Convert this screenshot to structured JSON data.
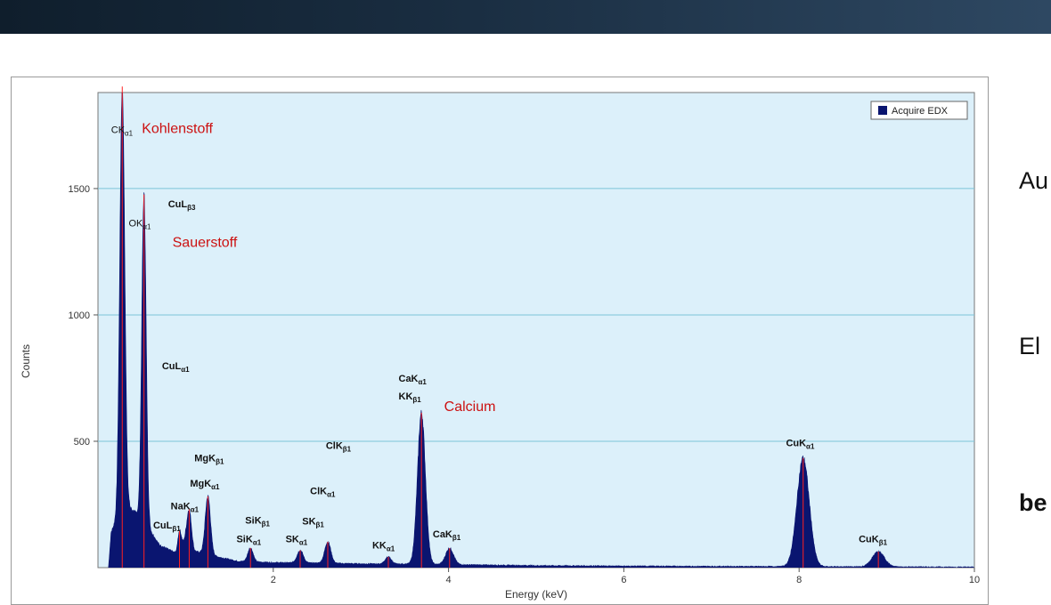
{
  "slide": {
    "side_texts": [
      "Au",
      "El",
      "be"
    ],
    "banner_color": "#1a2e42"
  },
  "chart_data": {
    "type": "area",
    "xlabel": "Energy (keV)",
    "ylabel": "Counts",
    "xlim": [
      0,
      10
    ],
    "ylim": [
      0,
      1880
    ],
    "xticks": [
      2,
      4,
      6,
      8,
      10
    ],
    "yticks": [
      500,
      1000,
      1500
    ],
    "grid": true,
    "plot_background": "#dcf0fa",
    "gridline_color": "#7cc4d8",
    "fill_color": "#0a1570",
    "marker_color": "#ff2020",
    "legend": {
      "label": "Acquire EDX",
      "position": "top-right",
      "color": "#0a1570"
    },
    "baseline_points": [
      [
        0.12,
        0
      ],
      [
        0.15,
        140
      ],
      [
        0.2,
        180
      ],
      [
        0.3,
        250
      ],
      [
        0.5,
        200
      ],
      [
        0.7,
        90
      ],
      [
        0.9,
        55
      ],
      [
        1.0,
        110
      ],
      [
        1.1,
        65
      ],
      [
        1.4,
        40
      ],
      [
        1.6,
        25
      ],
      [
        2.0,
        20
      ],
      [
        2.5,
        18
      ],
      [
        3.0,
        15
      ],
      [
        3.5,
        14
      ],
      [
        4.0,
        12
      ],
      [
        4.5,
        10
      ],
      [
        5.0,
        8
      ],
      [
        6.0,
        6
      ],
      [
        7.0,
        5
      ],
      [
        8.0,
        4
      ],
      [
        9.0,
        3
      ],
      [
        10.0,
        2
      ]
    ],
    "peaks": [
      {
        "energy": 0.277,
        "height": 1670,
        "width": 0.028,
        "line": "C Kα1",
        "element": "Kohlenstoff"
      },
      {
        "energy": 0.525,
        "height": 1290,
        "width": 0.025,
        "line": "O Kα1",
        "element": "Sauerstoff"
      },
      {
        "energy": 0.93,
        "height": 75,
        "width": 0.02,
        "line": "Cu Lα1"
      },
      {
        "energy": 1.041,
        "height": 140,
        "width": 0.025,
        "line": "Na Kα1"
      },
      {
        "energy": 1.254,
        "height": 230,
        "width": 0.03,
        "line": "Mg Kα1"
      },
      {
        "energy": 1.74,
        "height": 55,
        "width": 0.03,
        "line": "Si Kα1"
      },
      {
        "energy": 2.307,
        "height": 50,
        "width": 0.035,
        "line": "S Kα1"
      },
      {
        "energy": 2.622,
        "height": 85,
        "width": 0.035,
        "line": "Cl Kα1"
      },
      {
        "energy": 3.313,
        "height": 28,
        "width": 0.035,
        "line": "K Kα1"
      },
      {
        "energy": 3.691,
        "height": 600,
        "width": 0.045,
        "line": "Ca Kα1",
        "element": "Calcium"
      },
      {
        "energy": 4.012,
        "height": 65,
        "width": 0.045,
        "line": "Ca Kβ1"
      },
      {
        "energy": 8.046,
        "height": 430,
        "width": 0.07,
        "line": "Cu Kα1"
      },
      {
        "energy": 8.904,
        "height": 60,
        "width": 0.07,
        "line": "Cu Kβ1"
      }
    ],
    "annotations": [
      {
        "main": "CK",
        "sub": "α1",
        "x": 0.15,
        "y": 1720
      },
      {
        "main": "CuL",
        "sub": "β3",
        "x": 0.8,
        "y": 1425,
        "bold": true
      },
      {
        "main": "OK",
        "sub": "α1",
        "x": 0.35,
        "y": 1350
      },
      {
        "main": "CuL",
        "sub": "α1",
        "x": 0.73,
        "y": 785,
        "bold": true
      },
      {
        "main": "CaK",
        "sub": "α1",
        "x": 3.43,
        "y": 735,
        "bold": true
      },
      {
        "main": "KK",
        "sub": "β1",
        "x": 3.43,
        "y": 665,
        "bold": true
      },
      {
        "main": "ClK",
        "sub": "β1",
        "x": 2.6,
        "y": 470,
        "bold": true
      },
      {
        "main": "MgK",
        "sub": "β1",
        "x": 1.1,
        "y": 420,
        "bold": true
      },
      {
        "main": "MgK",
        "sub": "α1",
        "x": 1.05,
        "y": 320,
        "bold": true
      },
      {
        "main": "ClK",
        "sub": "α1",
        "x": 2.42,
        "y": 290,
        "bold": true
      },
      {
        "main": "NaK",
        "sub": "α1",
        "x": 0.83,
        "y": 230,
        "bold": true
      },
      {
        "main": "SiK",
        "sub": "β1",
        "x": 1.68,
        "y": 175,
        "bold": true
      },
      {
        "main": "SK",
        "sub": "β1",
        "x": 2.33,
        "y": 170,
        "bold": true
      },
      {
        "main": "CuL",
        "sub": "β1",
        "x": 0.63,
        "y": 155,
        "bold": true
      },
      {
        "main": "SiK",
        "sub": "α1",
        "x": 1.58,
        "y": 100,
        "bold": true
      },
      {
        "main": "SK",
        "sub": "α1",
        "x": 2.14,
        "y": 100,
        "bold": true
      },
      {
        "main": "CaK",
        "sub": "β1",
        "x": 3.82,
        "y": 120,
        "bold": true
      },
      {
        "main": "KK",
        "sub": "α1",
        "x": 3.13,
        "y": 75,
        "bold": true
      },
      {
        "main": "CuK",
        "sub": "α1",
        "x": 7.85,
        "y": 480,
        "bold": true
      },
      {
        "main": "CuK",
        "sub": "β1",
        "x": 8.68,
        "y": 100,
        "bold": true
      }
    ],
    "element_labels": [
      {
        "text": "Kohlenstoff",
        "x": 0.5,
        "y": 1720
      },
      {
        "text": "Sauerstoff",
        "x": 0.85,
        "y": 1270
      },
      {
        "text": "Calcium",
        "x": 3.95,
        "y": 620
      }
    ],
    "element_label_color": "#cc1111"
  }
}
